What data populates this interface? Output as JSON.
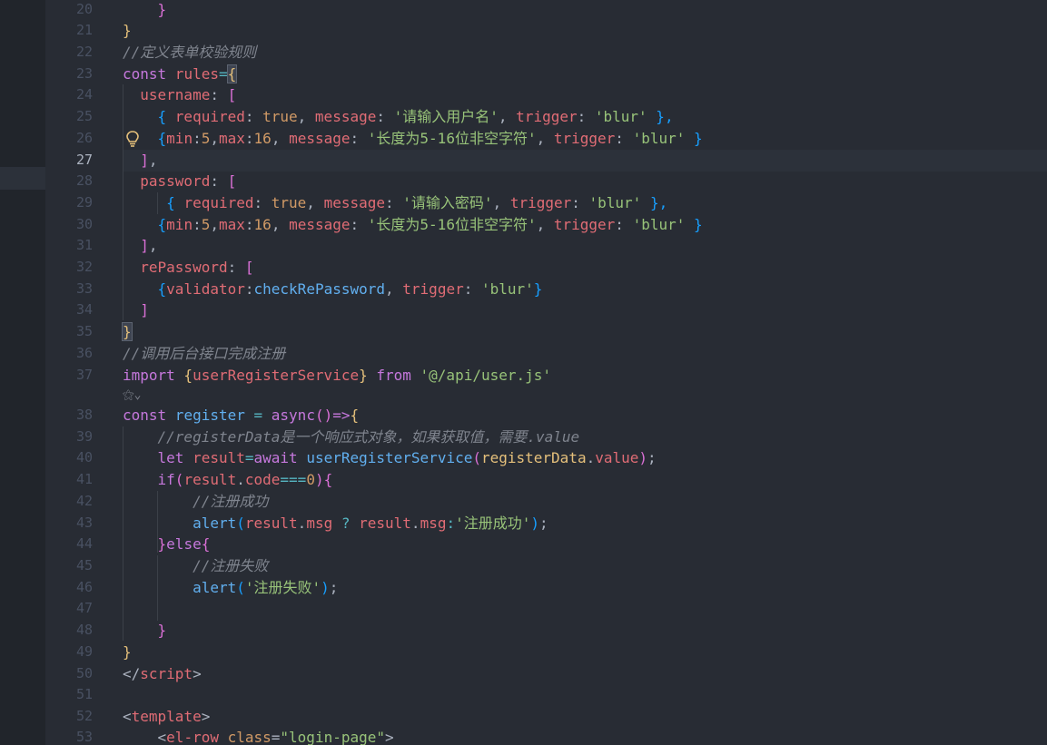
{
  "editor": {
    "line_numbers": [
      "20",
      "21",
      "22",
      "23",
      "24",
      "25",
      "26",
      "27",
      "28",
      "29",
      "30",
      "31",
      "32",
      "33",
      "34",
      "35",
      "36",
      "37",
      "38",
      "39",
      "40",
      "41",
      "42",
      "43",
      "44",
      "45",
      "46",
      "47",
      "48",
      "49",
      "50",
      "51",
      "52",
      "53"
    ],
    "active_line_number": "27",
    "codelens_text": "⚝⌄",
    "colors": {
      "background": "#282c34",
      "keyword": "#c678dd",
      "property": "#e06c75",
      "function": "#61afef",
      "string": "#98c379",
      "number": "#d19a66",
      "comment": "#7f848e"
    },
    "lines": {
      "l20": "    }",
      "l21": "}",
      "l22": "//定义表单校验规则",
      "l23a": "const",
      "l23b": " rules",
      "l23c": "=",
      "l23d": "{",
      "l24a": "  username",
      "l24b": ": ",
      "l24c": "[",
      "l25a": "    { ",
      "l25b": "required",
      "l25c": ": ",
      "l25d": "true",
      "l25e": ", ",
      "l25f": "message",
      "l25g": ": ",
      "l25h": "'请输入用户名'",
      "l25i": ", ",
      "l25j": "trigger",
      "l25k": ": ",
      "l25l": "'blur'",
      "l25m": " },",
      "l26a": "    {",
      "l26b": "min",
      "l26c": ":",
      "l26d": "5",
      "l26e": ",",
      "l26f": "max",
      "l26g": ":",
      "l26h": "16",
      "l26i": ", ",
      "l26j": "message",
      "l26k": ": ",
      "l26l": "'长度为5-16位非空字符'",
      "l26m": ", ",
      "l26n": "trigger",
      "l26o": ": ",
      "l26p": "'blur'",
      "l26q": " }",
      "l27a": "  ]",
      "l27b": ",",
      "l28a": "  password",
      "l28b": ": ",
      "l28c": "[",
      "l29a": "     { ",
      "l29b": "required",
      "l29c": ": ",
      "l29d": "true",
      "l29e": ", ",
      "l29f": "message",
      "l29g": ": ",
      "l29h": "'请输入密码'",
      "l29i": ", ",
      "l29j": "trigger",
      "l29k": ": ",
      "l29l": "'blur'",
      "l29m": " },",
      "l30a": "    {",
      "l30b": "min",
      "l30c": ":",
      "l30d": "5",
      "l30e": ",",
      "l30f": "max",
      "l30g": ":",
      "l30h": "16",
      "l30i": ", ",
      "l30j": "message",
      "l30k": ": ",
      "l30l": "'长度为5-16位非空字符'",
      "l30m": ", ",
      "l30n": "trigger",
      "l30o": ": ",
      "l30p": "'blur'",
      "l30q": " }",
      "l31a": "  ]",
      "l31b": ",",
      "l32a": "  rePassword",
      "l32b": ": ",
      "l32c": "[",
      "l33a": "    {",
      "l33b": "validator",
      "l33c": ":",
      "l33d": "checkRePassword",
      "l33e": ", ",
      "l33f": "trigger",
      "l33g": ": ",
      "l33h": "'blur'",
      "l33i": "}",
      "l34": "  ]",
      "l35": "}",
      "l36": "//调用后台接口完成注册",
      "l37a": "import",
      "l37b": " {",
      "l37c": "userRegisterService",
      "l37d": "}",
      "l37e": " from ",
      "l37f": "'@/api/user.js'",
      "l38a": "const",
      "l38b": " register",
      "l38c": " = ",
      "l38d": "async",
      "l38e": "()",
      "l38f": "=>",
      "l38g": "{",
      "l39": "    //registerData是一个响应式对象，如果获取值，需要.value",
      "l40a": "    let",
      "l40b": " result",
      "l40c": "=",
      "l40d": "await",
      "l40e": " userRegisterService",
      "l40f": "(",
      "l40g": "registerData",
      "l40h": ".",
      "l40i": "value",
      "l40j": ")",
      "l40k": ";",
      "l41a": "    if",
      "l41b": "(",
      "l41c": "result",
      "l41d": ".",
      "l41e": "code",
      "l41f": "===",
      "l41g": "0",
      "l41h": ")",
      "l41i": "{",
      "l42": "        //注册成功",
      "l43a": "        alert",
      "l43b": "(",
      "l43c": "result",
      "l43d": ".",
      "l43e": "msg",
      "l43f": " ? ",
      "l43g": "result",
      "l43h": ".",
      "l43i": "msg",
      "l43j": ":",
      "l43k": "'注册成功'",
      "l43l": ")",
      "l43m": ";",
      "l44a": "    }",
      "l44b": "else",
      "l44c": "{",
      "l45": "        //注册失败",
      "l46a": "        alert",
      "l46b": "(",
      "l46c": "'注册失败'",
      "l46d": ")",
      "l46e": ";",
      "l48": "    }",
      "l49": "}",
      "l50a": "</",
      "l50b": "script",
      "l50c": ">",
      "l52a": "<",
      "l52b": "template",
      "l52c": ">",
      "l53a": "    <",
      "l53b": "el-row",
      "l53c": " class",
      "l53d": "=",
      "l53e": "\"login-page\"",
      "l53f": ">"
    }
  }
}
